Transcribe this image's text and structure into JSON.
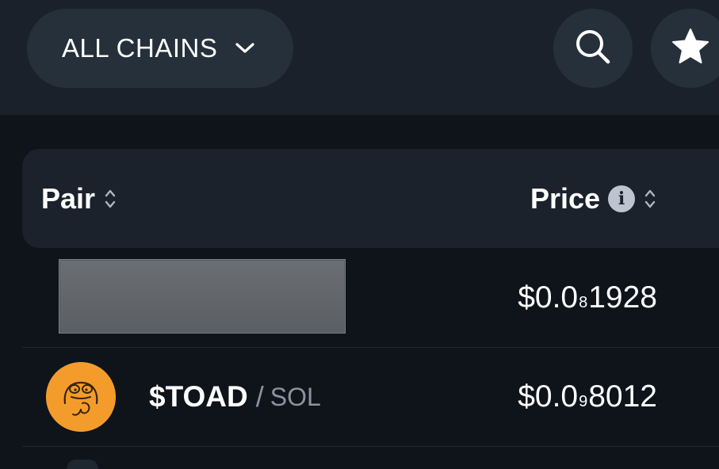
{
  "toolbar": {
    "chain_select_label": "ALL CHAINS",
    "chain_chevron_icon": "chevron-down-icon",
    "search_icon": "search-icon",
    "watchlist_icon": "star-icon"
  },
  "table": {
    "columns": {
      "pair": "Pair",
      "price": "Price"
    },
    "rows": [
      {
        "pair_redacted": true,
        "price": {
          "prefix": "$0.0",
          "zeros": "8",
          "digits": "1928"
        }
      },
      {
        "base": "$TOAD",
        "separator": "/",
        "quote": "SOL",
        "avatar_icon": "toad-token-icon",
        "price": {
          "prefix": "$0.0",
          "zeros": "9",
          "digits": "8012"
        }
      }
    ]
  },
  "colors": {
    "background": "#0f141b",
    "topbar": "#1a212a",
    "pill": "#25303a",
    "header_row": "#1b222b",
    "token_orange": "#f39c2c",
    "muted_text": "#8a939e"
  }
}
